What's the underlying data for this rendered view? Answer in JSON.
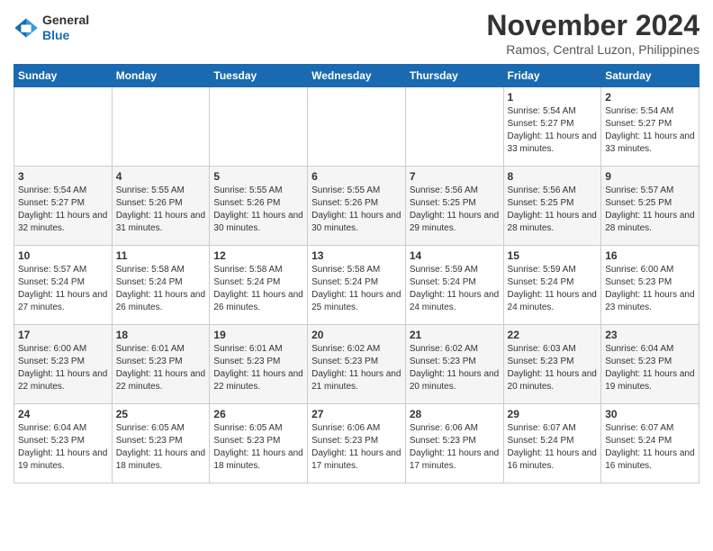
{
  "header": {
    "logo_general": "General",
    "logo_blue": "Blue",
    "month": "November 2024",
    "location": "Ramos, Central Luzon, Philippines"
  },
  "days_of_week": [
    "Sunday",
    "Monday",
    "Tuesday",
    "Wednesday",
    "Thursday",
    "Friday",
    "Saturday"
  ],
  "weeks": [
    [
      {
        "day": "",
        "sunrise": "",
        "sunset": "",
        "daylight": ""
      },
      {
        "day": "",
        "sunrise": "",
        "sunset": "",
        "daylight": ""
      },
      {
        "day": "",
        "sunrise": "",
        "sunset": "",
        "daylight": ""
      },
      {
        "day": "",
        "sunrise": "",
        "sunset": "",
        "daylight": ""
      },
      {
        "day": "",
        "sunrise": "",
        "sunset": "",
        "daylight": ""
      },
      {
        "day": "1",
        "sunrise": "Sunrise: 5:54 AM",
        "sunset": "Sunset: 5:27 PM",
        "daylight": "Daylight: 11 hours and 33 minutes."
      },
      {
        "day": "2",
        "sunrise": "Sunrise: 5:54 AM",
        "sunset": "Sunset: 5:27 PM",
        "daylight": "Daylight: 11 hours and 33 minutes."
      }
    ],
    [
      {
        "day": "3",
        "sunrise": "Sunrise: 5:54 AM",
        "sunset": "Sunset: 5:27 PM",
        "daylight": "Daylight: 11 hours and 32 minutes."
      },
      {
        "day": "4",
        "sunrise": "Sunrise: 5:55 AM",
        "sunset": "Sunset: 5:26 PM",
        "daylight": "Daylight: 11 hours and 31 minutes."
      },
      {
        "day": "5",
        "sunrise": "Sunrise: 5:55 AM",
        "sunset": "Sunset: 5:26 PM",
        "daylight": "Daylight: 11 hours and 30 minutes."
      },
      {
        "day": "6",
        "sunrise": "Sunrise: 5:55 AM",
        "sunset": "Sunset: 5:26 PM",
        "daylight": "Daylight: 11 hours and 30 minutes."
      },
      {
        "day": "7",
        "sunrise": "Sunrise: 5:56 AM",
        "sunset": "Sunset: 5:25 PM",
        "daylight": "Daylight: 11 hours and 29 minutes."
      },
      {
        "day": "8",
        "sunrise": "Sunrise: 5:56 AM",
        "sunset": "Sunset: 5:25 PM",
        "daylight": "Daylight: 11 hours and 28 minutes."
      },
      {
        "day": "9",
        "sunrise": "Sunrise: 5:57 AM",
        "sunset": "Sunset: 5:25 PM",
        "daylight": "Daylight: 11 hours and 28 minutes."
      }
    ],
    [
      {
        "day": "10",
        "sunrise": "Sunrise: 5:57 AM",
        "sunset": "Sunset: 5:24 PM",
        "daylight": "Daylight: 11 hours and 27 minutes."
      },
      {
        "day": "11",
        "sunrise": "Sunrise: 5:58 AM",
        "sunset": "Sunset: 5:24 PM",
        "daylight": "Daylight: 11 hours and 26 minutes."
      },
      {
        "day": "12",
        "sunrise": "Sunrise: 5:58 AM",
        "sunset": "Sunset: 5:24 PM",
        "daylight": "Daylight: 11 hours and 26 minutes."
      },
      {
        "day": "13",
        "sunrise": "Sunrise: 5:58 AM",
        "sunset": "Sunset: 5:24 PM",
        "daylight": "Daylight: 11 hours and 25 minutes."
      },
      {
        "day": "14",
        "sunrise": "Sunrise: 5:59 AM",
        "sunset": "Sunset: 5:24 PM",
        "daylight": "Daylight: 11 hours and 24 minutes."
      },
      {
        "day": "15",
        "sunrise": "Sunrise: 5:59 AM",
        "sunset": "Sunset: 5:24 PM",
        "daylight": "Daylight: 11 hours and 24 minutes."
      },
      {
        "day": "16",
        "sunrise": "Sunrise: 6:00 AM",
        "sunset": "Sunset: 5:23 PM",
        "daylight": "Daylight: 11 hours and 23 minutes."
      }
    ],
    [
      {
        "day": "17",
        "sunrise": "Sunrise: 6:00 AM",
        "sunset": "Sunset: 5:23 PM",
        "daylight": "Daylight: 11 hours and 22 minutes."
      },
      {
        "day": "18",
        "sunrise": "Sunrise: 6:01 AM",
        "sunset": "Sunset: 5:23 PM",
        "daylight": "Daylight: 11 hours and 22 minutes."
      },
      {
        "day": "19",
        "sunrise": "Sunrise: 6:01 AM",
        "sunset": "Sunset: 5:23 PM",
        "daylight": "Daylight: 11 hours and 22 minutes."
      },
      {
        "day": "20",
        "sunrise": "Sunrise: 6:02 AM",
        "sunset": "Sunset: 5:23 PM",
        "daylight": "Daylight: 11 hours and 21 minutes."
      },
      {
        "day": "21",
        "sunrise": "Sunrise: 6:02 AM",
        "sunset": "Sunset: 5:23 PM",
        "daylight": "Daylight: 11 hours and 20 minutes."
      },
      {
        "day": "22",
        "sunrise": "Sunrise: 6:03 AM",
        "sunset": "Sunset: 5:23 PM",
        "daylight": "Daylight: 11 hours and 20 minutes."
      },
      {
        "day": "23",
        "sunrise": "Sunrise: 6:04 AM",
        "sunset": "Sunset: 5:23 PM",
        "daylight": "Daylight: 11 hours and 19 minutes."
      }
    ],
    [
      {
        "day": "24",
        "sunrise": "Sunrise: 6:04 AM",
        "sunset": "Sunset: 5:23 PM",
        "daylight": "Daylight: 11 hours and 19 minutes."
      },
      {
        "day": "25",
        "sunrise": "Sunrise: 6:05 AM",
        "sunset": "Sunset: 5:23 PM",
        "daylight": "Daylight: 11 hours and 18 minutes."
      },
      {
        "day": "26",
        "sunrise": "Sunrise: 6:05 AM",
        "sunset": "Sunset: 5:23 PM",
        "daylight": "Daylight: 11 hours and 18 minutes."
      },
      {
        "day": "27",
        "sunrise": "Sunrise: 6:06 AM",
        "sunset": "Sunset: 5:23 PM",
        "daylight": "Daylight: 11 hours and 17 minutes."
      },
      {
        "day": "28",
        "sunrise": "Sunrise: 6:06 AM",
        "sunset": "Sunset: 5:23 PM",
        "daylight": "Daylight: 11 hours and 17 minutes."
      },
      {
        "day": "29",
        "sunrise": "Sunrise: 6:07 AM",
        "sunset": "Sunset: 5:24 PM",
        "daylight": "Daylight: 11 hours and 16 minutes."
      },
      {
        "day": "30",
        "sunrise": "Sunrise: 6:07 AM",
        "sunset": "Sunset: 5:24 PM",
        "daylight": "Daylight: 11 hours and 16 minutes."
      }
    ]
  ]
}
